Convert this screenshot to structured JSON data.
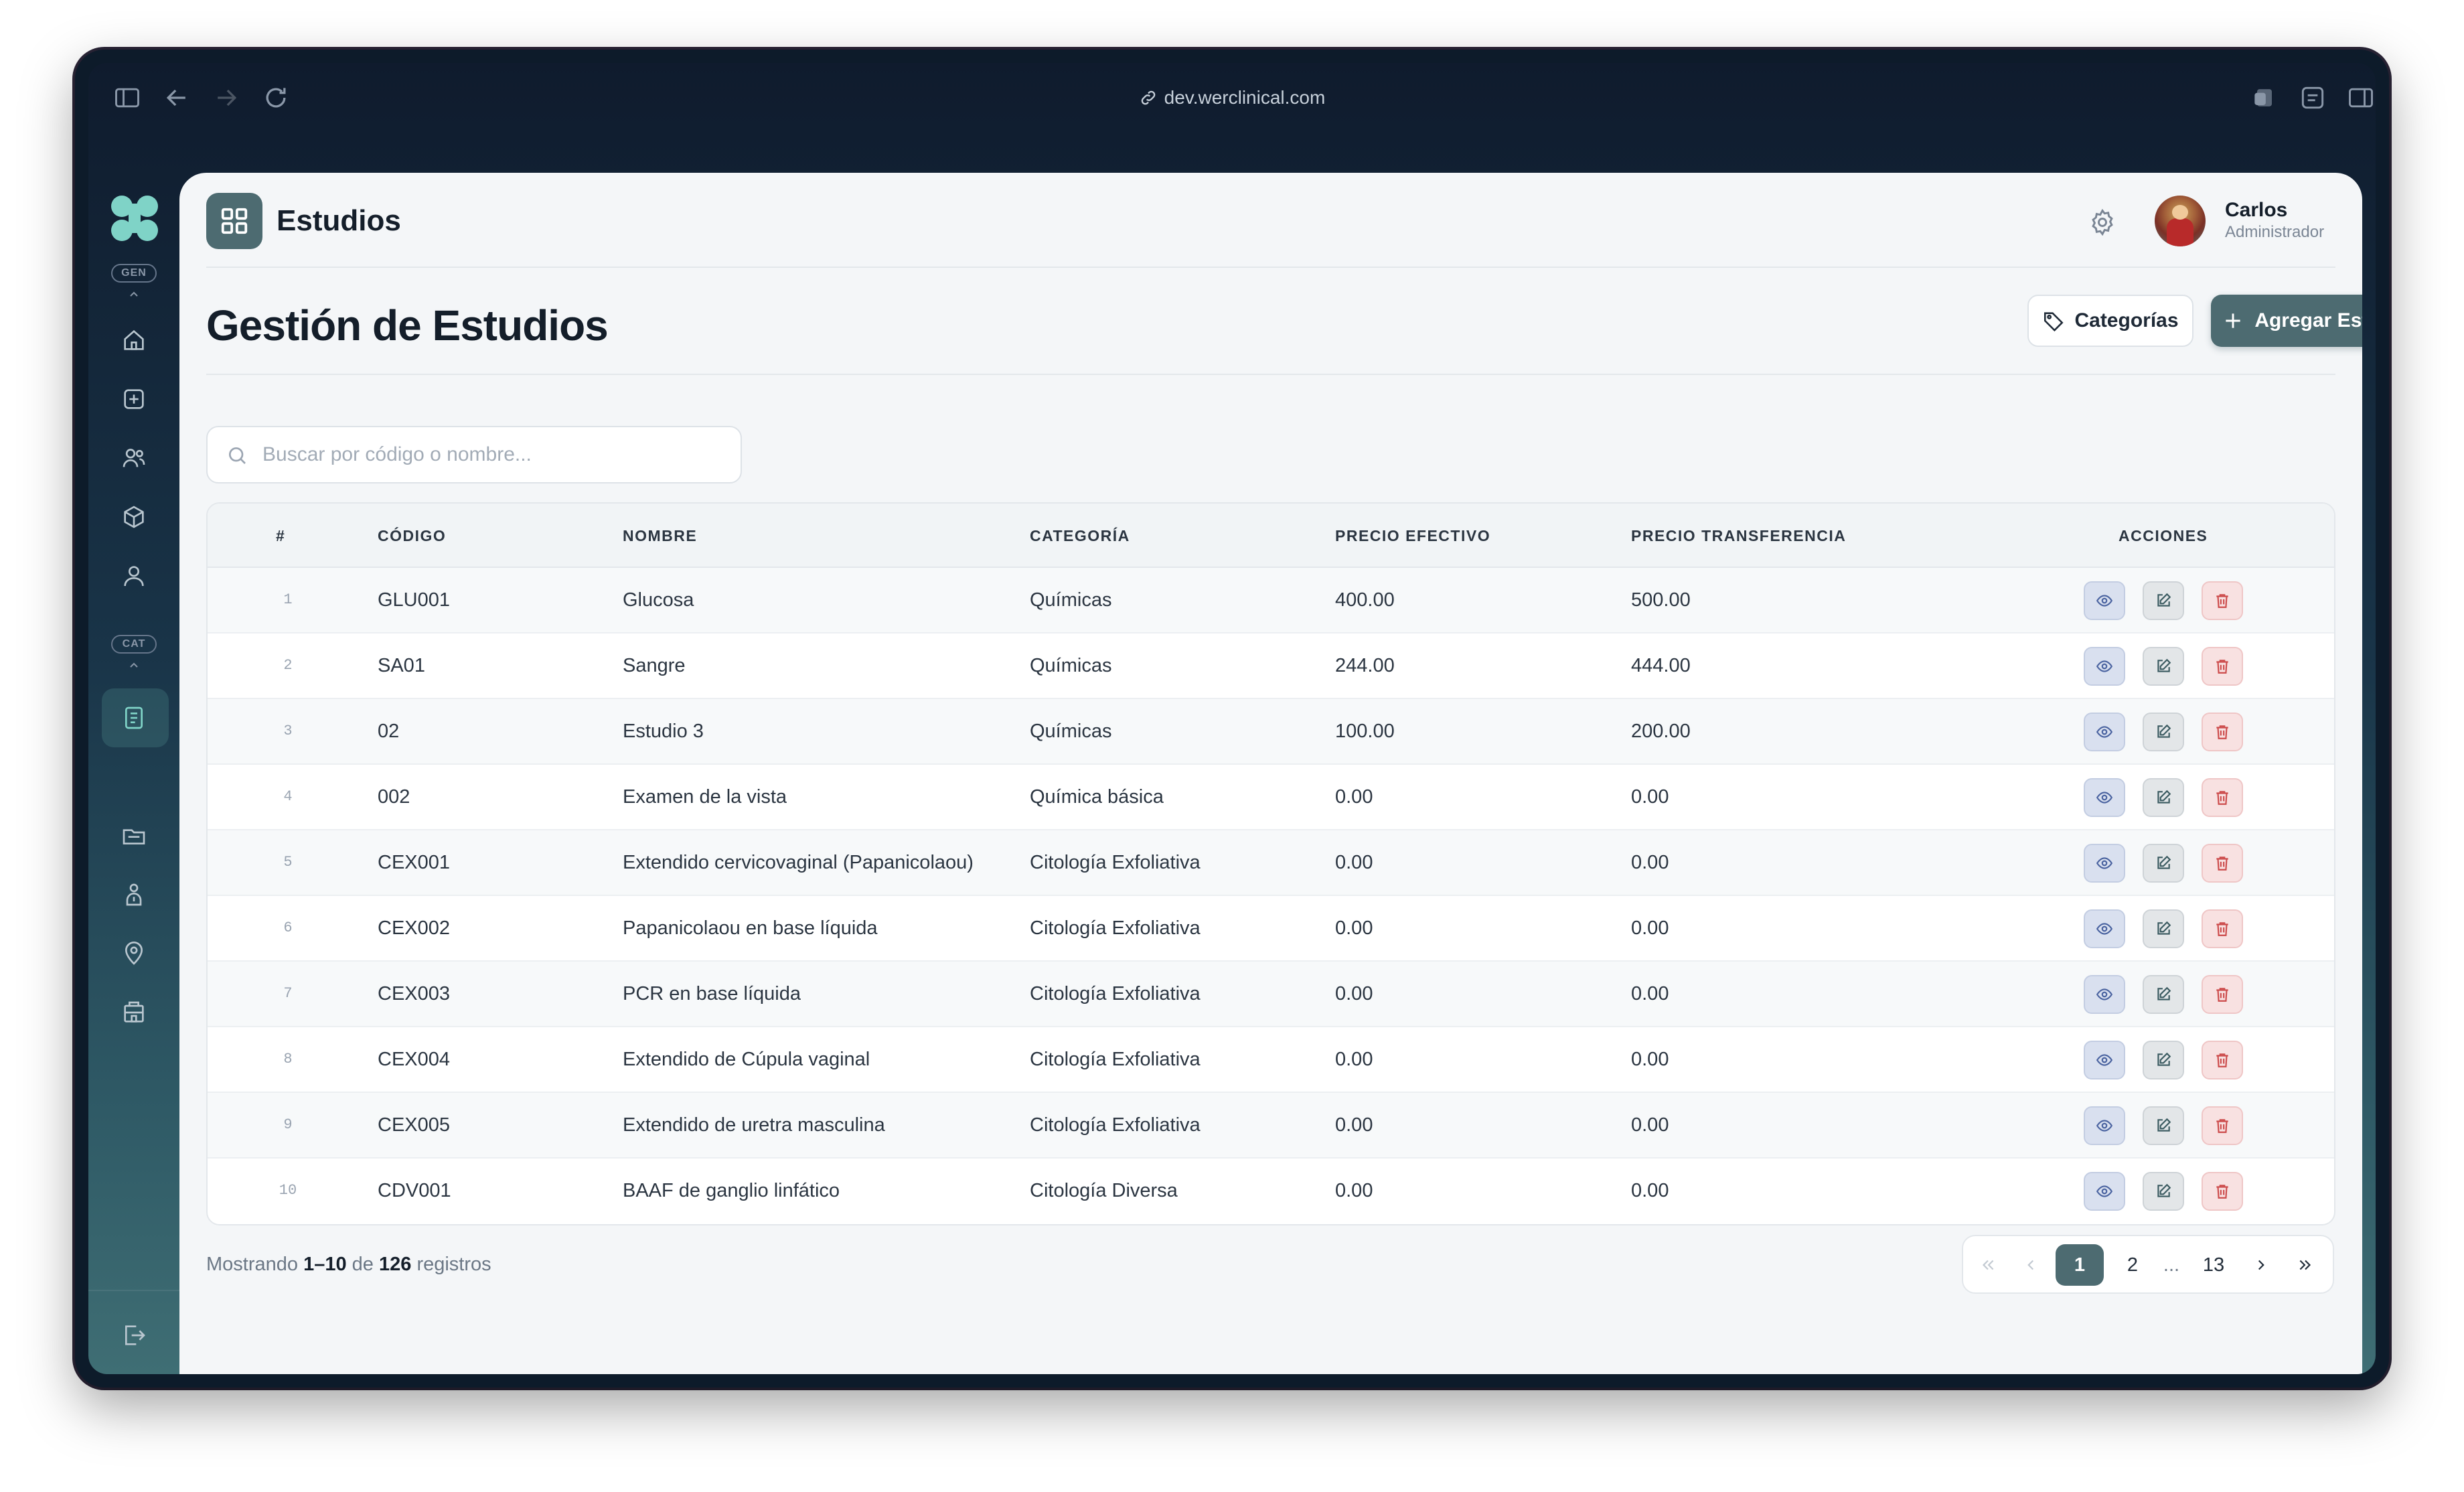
{
  "browser": {
    "url": "dev.werclinical.com"
  },
  "sidebar": {
    "section_gen": "GEN",
    "section_cat": "CAT"
  },
  "header": {
    "app_title": "Estudios",
    "user_name": "Carlos",
    "user_role": "Administrador"
  },
  "page": {
    "title": "Gestión de Estudios",
    "categories_button": "Categorías",
    "add_button": "Agregar Estudio"
  },
  "search": {
    "placeholder": "Buscar por código o nombre..."
  },
  "table": {
    "columns": [
      "#",
      "CÓDIGO",
      "NOMBRE",
      "CATEGORÍA",
      "PRECIO EFECTIVO",
      "PRECIO TRANSFERENCIA",
      "ACCIONES"
    ],
    "rows": [
      {
        "n": "1",
        "code": "GLU001",
        "name": "Glucosa",
        "category": "Químicas",
        "cash": "400.00",
        "transfer": "500.00"
      },
      {
        "n": "2",
        "code": "SA01",
        "name": "Sangre",
        "category": "Químicas",
        "cash": "244.00",
        "transfer": "444.00"
      },
      {
        "n": "3",
        "code": "02",
        "name": "Estudio 3",
        "category": "Químicas",
        "cash": "100.00",
        "transfer": "200.00"
      },
      {
        "n": "4",
        "code": "002",
        "name": "Examen de la vista",
        "category": "Química básica",
        "cash": "0.00",
        "transfer": "0.00"
      },
      {
        "n": "5",
        "code": "CEX001",
        "name": "Extendido cervicovaginal (Papanicolaou)",
        "category": "Citología Exfoliativa",
        "cash": "0.00",
        "transfer": "0.00"
      },
      {
        "n": "6",
        "code": "CEX002",
        "name": "Papanicolaou en base líquida",
        "category": "Citología Exfoliativa",
        "cash": "0.00",
        "transfer": "0.00"
      },
      {
        "n": "7",
        "code": "CEX003",
        "name": "PCR en base líquida",
        "category": "Citología Exfoliativa",
        "cash": "0.00",
        "transfer": "0.00"
      },
      {
        "n": "8",
        "code": "CEX004",
        "name": "Extendido de Cúpula vaginal",
        "category": "Citología Exfoliativa",
        "cash": "0.00",
        "transfer": "0.00"
      },
      {
        "n": "9",
        "code": "CEX005",
        "name": "Extendido de uretra masculina",
        "category": "Citología Exfoliativa",
        "cash": "0.00",
        "transfer": "0.00"
      },
      {
        "n": "10",
        "code": "CDV001",
        "name": "BAAF de ganglio linfático",
        "category": "Citología Diversa",
        "cash": "0.00",
        "transfer": "0.00"
      }
    ],
    "actions": [
      "eye-icon",
      "edit-icon",
      "trash-icon"
    ]
  },
  "footer": {
    "prefix": "Mostrando",
    "range": "1–10",
    "of": "de",
    "total": "126",
    "suffix": "registros"
  },
  "pagination": {
    "pages": [
      "1",
      "2",
      "...",
      "13"
    ],
    "current": "1"
  },
  "colors": {
    "accent": "#4d6b71",
    "view": "#4a63a0",
    "delete": "#cc4b4b"
  }
}
